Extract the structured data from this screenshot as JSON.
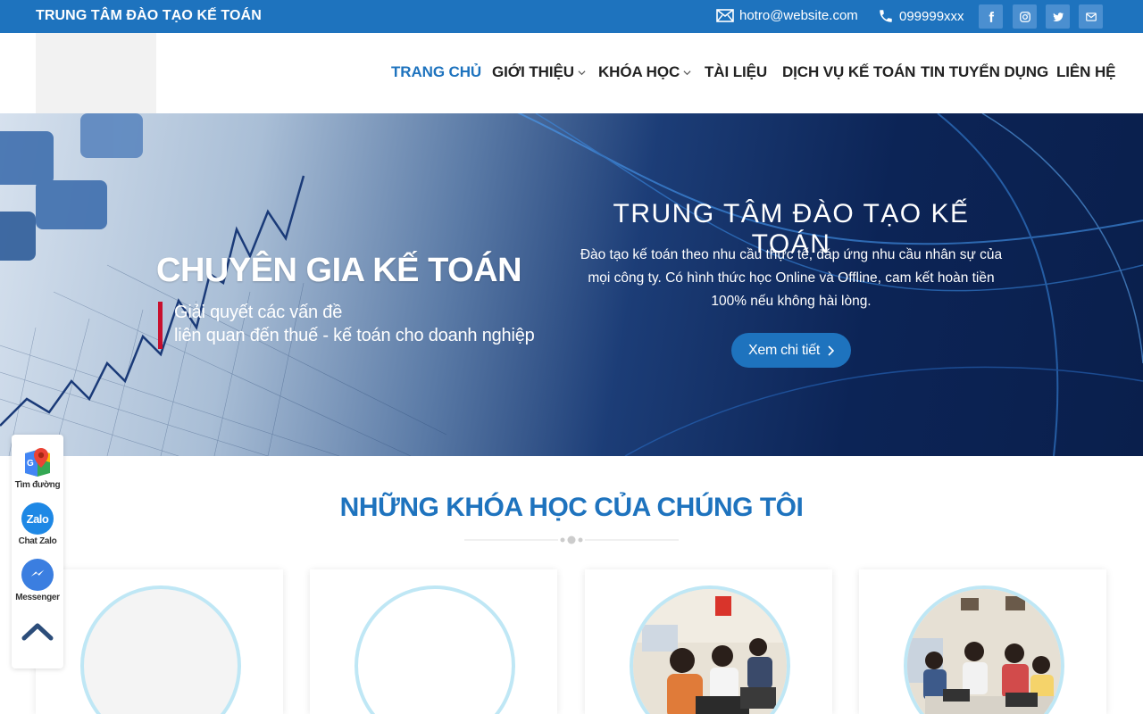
{
  "topbar": {
    "brand": "TRUNG TÂM ĐÀO TẠO KẾ TOÁN",
    "email": "hotro@website.com",
    "phone": "099999xxx",
    "social": [
      "facebook-icon",
      "instagram-icon",
      "twitter-icon",
      "envelope-icon"
    ]
  },
  "nav": {
    "items": [
      {
        "label": "TRANG CHỦ",
        "active": true
      },
      {
        "label": "GIỚI THIỆU",
        "dropdown": true
      },
      {
        "label": "KHÓA HỌC",
        "dropdown": true
      },
      {
        "label": "TÀI LIỆU"
      },
      {
        "label": "DỊCH VỤ KẾ TOÁN"
      },
      {
        "label": "TIN TUYỂN DỤNG"
      },
      {
        "label": "LIÊN HỆ"
      }
    ]
  },
  "hero": {
    "left_title": "CHUYÊN GIA KẾ TOÁN",
    "left_sub_1": "Giải quyết các vấn đề",
    "left_sub_2": "liên quan đến thuế - kế toán cho doanh nghiệp",
    "right_title": "TRUNG TÂM ĐÀO TẠO KẾ TOÁN",
    "right_desc": "Đào tạo kế toán theo nhu cầu thực tế, đáp ứng nhu cầu nhân sự của mọi công ty. Có hình thức học Online và Offline, cam kết hoàn tiền 100% nếu không hài lòng.",
    "cta": "Xem chi tiết"
  },
  "courses": {
    "title": "NHỮNG KHÓA HỌC CỦA CHÚNG TÔI"
  },
  "float_widget": {
    "map": "Tìm đường",
    "zalo": "Chat Zalo",
    "zalo_logo": "Zalo",
    "messenger": "Messenger"
  },
  "colors": {
    "primary": "#1e73be",
    "accent_red": "#c8102e"
  }
}
